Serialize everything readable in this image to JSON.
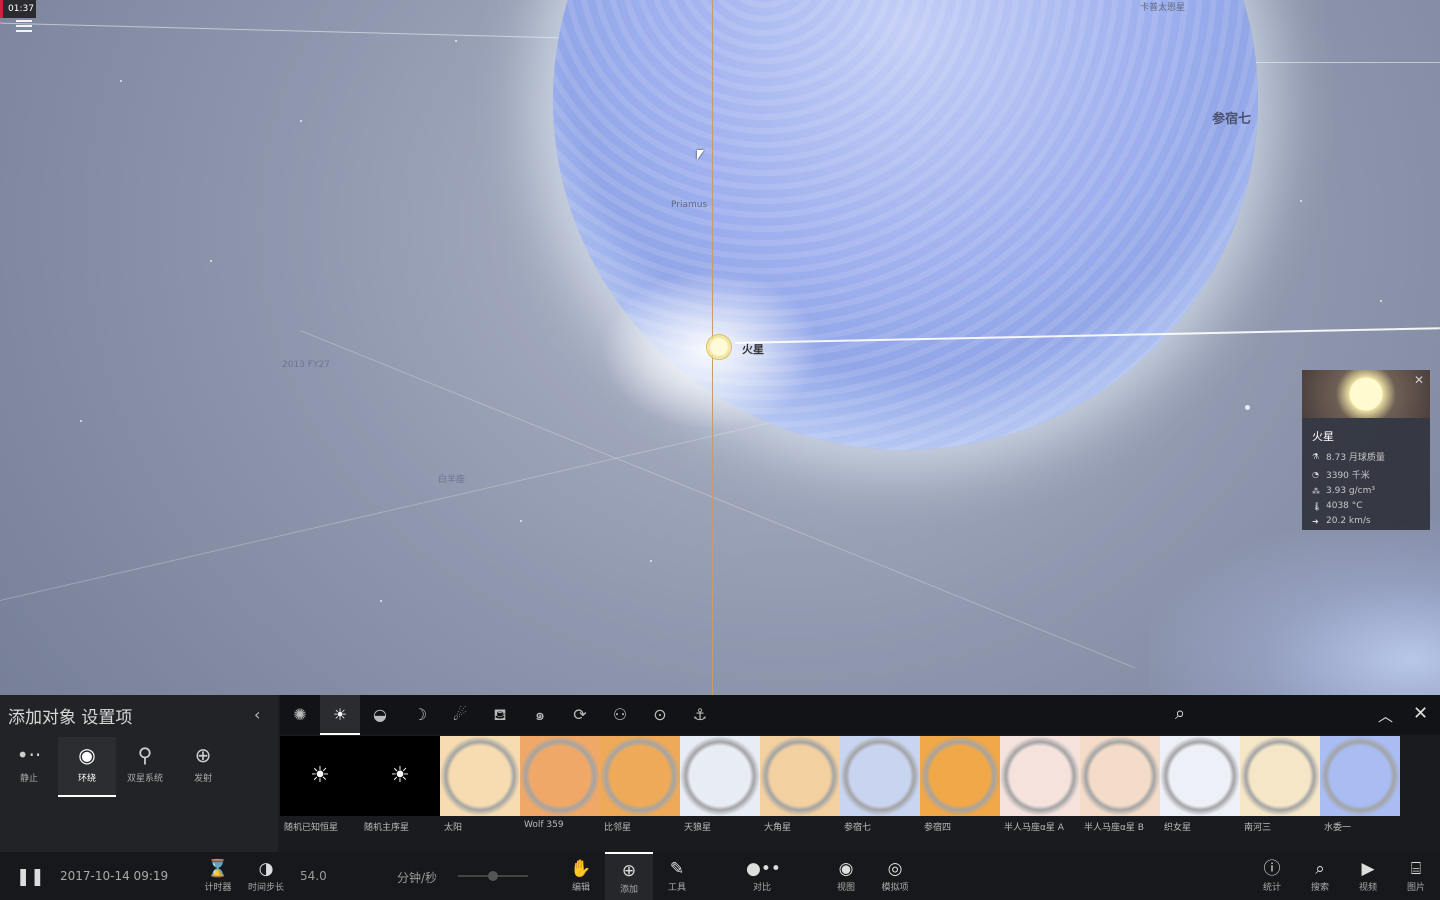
{
  "time": "01:37",
  "sky_labels": [
    {
      "text": "卡普太恩星",
      "color": "#4a5070"
    },
    {
      "text": "参宿七",
      "color": "#4a5070"
    },
    {
      "text": "Priamus",
      "color": "#5f6680"
    },
    {
      "text": "火星",
      "color": "#333"
    },
    {
      "text": "2013 FY27",
      "color": "#6f7490"
    },
    {
      "text": "白羊座",
      "color": "#6f7490"
    }
  ],
  "info_card": {
    "title": "火星",
    "rows": [
      {
        "icon": "mass-icon",
        "value": "8.73 月球质量"
      },
      {
        "icon": "radius-icon",
        "value": "3390 千米"
      },
      {
        "icon": "density-icon",
        "value": "3.93 g/cm³"
      },
      {
        "icon": "temperature-icon",
        "value": "4038 °C"
      },
      {
        "icon": "velocity-icon",
        "value": "20.2 km/s"
      }
    ]
  },
  "panel": {
    "title": "添加对象  设置项",
    "modes": [
      {
        "label": "静止",
        "icon": "•··"
      },
      {
        "label": "环绕",
        "icon": "◉"
      },
      {
        "label": "双星系统",
        "icon": "⚲"
      },
      {
        "label": "发射",
        "icon": "⊕"
      }
    ],
    "items": [
      {
        "label": "随机已知恒星",
        "color": "#000"
      },
      {
        "label": "随机主序星",
        "color": "#000"
      },
      {
        "label": "太阳",
        "color": "#f6dcb0"
      },
      {
        "label": "Wolf 359",
        "color": "#f0a868"
      },
      {
        "label": "比邻星",
        "color": "#eeaa58"
      },
      {
        "label": "天狼星",
        "color": "#e8ecf5"
      },
      {
        "label": "大角星",
        "color": "#f2d0a0"
      },
      {
        "label": "参宿七",
        "color": "#c8d4f0"
      },
      {
        "label": "参宿四",
        "color": "#f0a848"
      },
      {
        "label": "半人马座α星 A",
        "color": "#f5e2dc"
      },
      {
        "label": "半人马座α星 B",
        "color": "#f4dcc8"
      },
      {
        "label": "织女星",
        "color": "#eef0f8"
      },
      {
        "label": "南河三",
        "color": "#f6e6c8"
      },
      {
        "label": "水委一",
        "color": "#a9bdf2"
      }
    ]
  },
  "bottom": {
    "datetime": "2017-10-14 09:19",
    "timer_label": "计时器",
    "timestep_label": "时间步长",
    "timestep_value": "54.0",
    "unit": "分钟/秒",
    "edit": "编辑",
    "add": "添加",
    "tools": "工具",
    "compare": "对比",
    "view": "视图",
    "simulate": "模拟项",
    "stats": "统计",
    "search": "搜索",
    "video": "视频",
    "photo": "图片"
  }
}
